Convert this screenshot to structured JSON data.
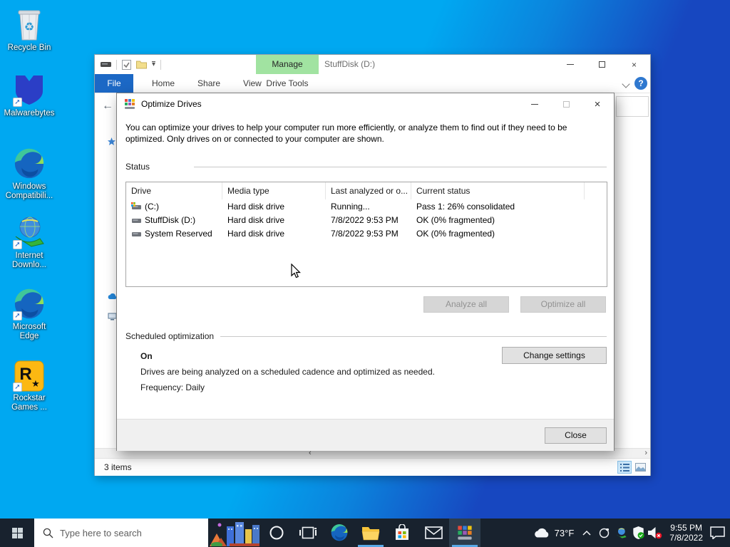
{
  "desktop": {
    "icons": [
      {
        "line1": "Recycle Bin",
        "line2": ""
      },
      {
        "line1": "Malwarebytes",
        "line2": ""
      },
      {
        "line1": "Windows",
        "line2": "Compatibili..."
      },
      {
        "line1": "Internet",
        "line2": "Downlo..."
      },
      {
        "line1": "Microsoft",
        "line2": "Edge"
      },
      {
        "line1": "Rockstar",
        "line2": "Games ..."
      }
    ]
  },
  "explorer": {
    "manage_tab": "Manage",
    "title": "StuffDisk (D:)",
    "tabs": [
      "File",
      "Home",
      "Share",
      "View",
      "Drive Tools"
    ],
    "status_items": "3 items"
  },
  "dialog": {
    "title": "Optimize Drives",
    "description": "You can optimize your drives to help your computer run more efficiently, or analyze them to find out if they need to be optimized. Only drives on or connected to your computer are shown.",
    "status_label": "Status",
    "table": {
      "headers": [
        "Drive",
        "Media type",
        "Last analyzed or o...",
        "Current status"
      ],
      "rows": [
        {
          "drive": "(C:)",
          "media": "Hard disk drive",
          "last": "Running...",
          "status": "Pass 1: 26% consolidated"
        },
        {
          "drive": "StuffDisk (D:)",
          "media": "Hard disk drive",
          "last": "7/8/2022 9:53 PM",
          "status": "OK (0% fragmented)"
        },
        {
          "drive": "System Reserved",
          "media": "Hard disk drive",
          "last": "7/8/2022 9:53 PM",
          "status": "OK (0% fragmented)"
        }
      ]
    },
    "analyze_button": "Analyze all",
    "optimize_button": "Optimize all",
    "scheduled_label": "Scheduled optimization",
    "scheduled_state": "On",
    "scheduled_desc": "Drives are being analyzed on a scheduled cadence and optimized as needed.",
    "scheduled_freq": "Frequency: Daily",
    "change_button": "Change settings",
    "close_button": "Close"
  },
  "taskbar": {
    "search_placeholder": "Type here to search",
    "temperature": "73°F",
    "time": "9:55 PM",
    "date": "7/8/2022"
  },
  "glyphs": {
    "close": "×",
    "back": "←",
    "help": "?",
    "dropdown": "▾",
    "scroll_left": "‹",
    "scroll_right": "›",
    "recycle": "♻",
    "shortcut": "➚",
    "r_letter": "R",
    "r_star": "★"
  },
  "colors": {
    "accent": "#0078d7",
    "manage_tab_green": "#a1e3a1",
    "file_tab_blue": "#1c68c5",
    "desktop_light": "#00a8f1",
    "desktop_dark": "#1747c0",
    "taskbar": "#18222e"
  }
}
